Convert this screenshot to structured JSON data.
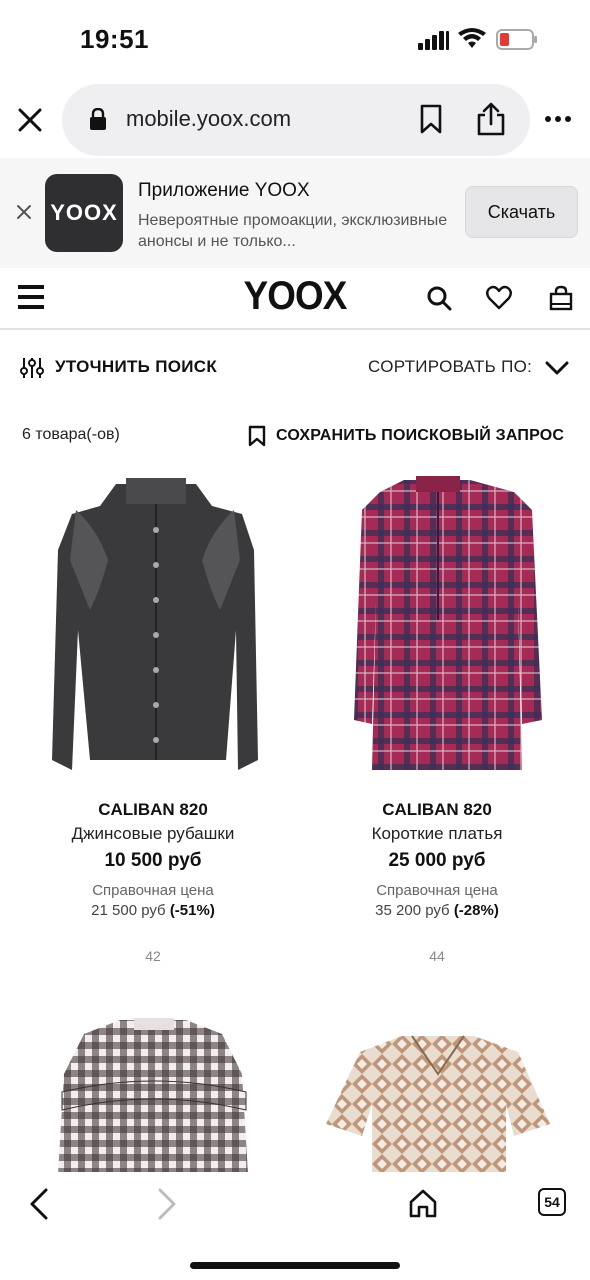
{
  "status": {
    "time": "19:51"
  },
  "browser": {
    "url": "mobile.yoox.com"
  },
  "banner": {
    "logo_text": "YOOX",
    "title": "Приложение YOOX",
    "subtitle": "Невероятные промоакции, эксклюзивные анонсы и не только...",
    "download_label": "Скачать"
  },
  "header": {
    "brand": "YOOX"
  },
  "filters": {
    "refine_label": "УТОЧНИТЬ ПОИСК",
    "sort_label": "СОРТИРОВАТЬ ПО:"
  },
  "results": {
    "count": "6 товара(-ов)",
    "save_search_label": "СОХРАНИТЬ ПОИСКОВЫЙ ЗАПРОС"
  },
  "products": [
    {
      "brand": "CALIBAN 820",
      "category": "Джинсовые рубашки",
      "price": "10 500 руб",
      "ref_label": "Справочная цена",
      "ref_price": "21 500 руб",
      "discount": "(-51%)",
      "size": "42"
    },
    {
      "brand": "CALIBAN 820",
      "category": "Короткие платья",
      "price": "25 000 руб",
      "ref_label": "Справочная цена",
      "ref_price": "35 200 руб",
      "discount": "(-28%)",
      "size": "44"
    }
  ],
  "bottombar": {
    "tabs_count": "54"
  },
  "colors": {
    "denim": "#3a3a3c",
    "plaid_base": "#a52a55",
    "plaid_dark": "#3b2f57",
    "gingham": "#3a3030",
    "print": "#b88a6a"
  }
}
